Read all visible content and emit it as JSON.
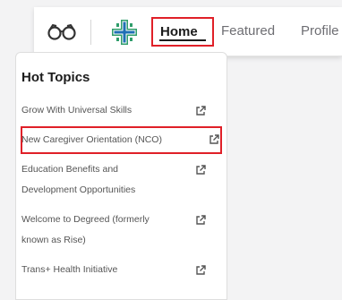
{
  "nav": {
    "tabs": [
      {
        "label": "Home",
        "active": true
      },
      {
        "label": "Featured",
        "active": false
      },
      {
        "label": "Profile",
        "active": false
      }
    ],
    "highlight_color": "#e02028",
    "logo_colors": {
      "primary": "#2f9d6b",
      "accent": "#1f6fb5"
    }
  },
  "hot_topics": {
    "title": "Hot Topics",
    "items": [
      {
        "line1": "Grow With Universal Skills",
        "line2": "",
        "icon": "external-link-icon"
      },
      {
        "line1": "New Caregiver Orientation (NCO)",
        "line2": "",
        "icon": "external-link-icon",
        "highlighted": true
      },
      {
        "line1": "Education Benefits and",
        "line2": "Development Opportunities",
        "icon": "external-link-icon"
      },
      {
        "line1": "Welcome to Degreed (formerly",
        "line2": "known as Rise)",
        "icon": "external-link-icon"
      },
      {
        "line1": "Trans+ Health Initiative",
        "line2": "",
        "icon": "external-link-icon"
      }
    ]
  }
}
